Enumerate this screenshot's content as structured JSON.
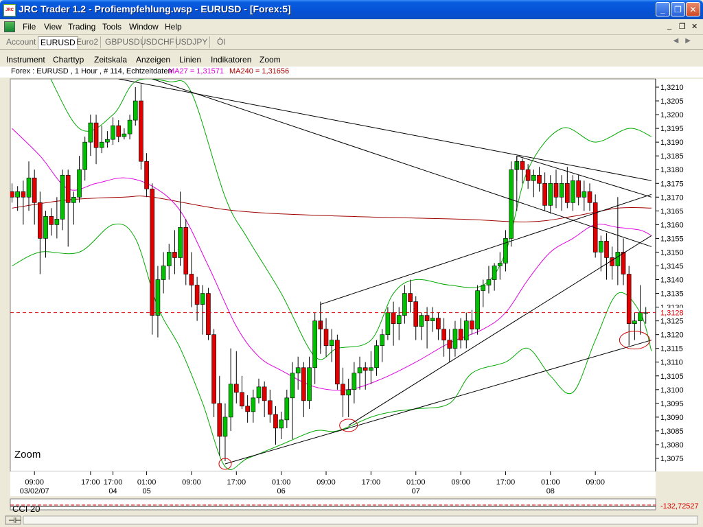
{
  "window": {
    "title": "JRC Trader 1.2 - Profiempfehlung.wsp - EURUSD - [Forex:5]",
    "icon_text": "JRC",
    "minimize": "_",
    "maximize": "❐",
    "close": "✕"
  },
  "menu": [
    "File",
    "View",
    "Trading",
    "Tools",
    "Window",
    "Help"
  ],
  "mdi": {
    "minimize": "_",
    "restore": "❐",
    "close": "✕"
  },
  "tabs": [
    "Account",
    "EURUSD",
    "Euro2",
    "GBPUSD",
    "USDCHF",
    "USDJPY",
    "Öl"
  ],
  "active_tab": "EURUSD",
  "chart_menu": [
    "Instrument",
    "Charttyp",
    "Zeitskala",
    "Anzeigen",
    "Linien",
    "Indikatoren",
    "Zoom"
  ],
  "info": {
    "main": "Forex : EURUSD , 1 Hour , # 114, Echtzeitdaten",
    "ma27": "MA27 = 1,31571",
    "ma240": "MA240 = 1,31656",
    "ma27_color": "#dd00dd",
    "ma240_color": "#aa0000"
  },
  "zoom_label": "Zoom",
  "cci": {
    "label": "CCI 20",
    "value": "-132,72527"
  },
  "colors": {
    "up": "#00c000",
    "down": "#e00000",
    "bollinger": "#00aa00",
    "ma27": "#e000e0",
    "ma240": "#a00000",
    "price_line": "#dd0000"
  },
  "chart_data": {
    "type": "candlestick",
    "instrument": "EURUSD",
    "timeframe": "1 Hour",
    "ylim": [
      1.307,
      1.3215
    ],
    "y_ticks": [
      "1,3210",
      "1,3205",
      "1,3200",
      "1,3195",
      "1,3190",
      "1,3185",
      "1,3180",
      "1,3175",
      "1,3170",
      "1,3165",
      "1,3160",
      "1,3155",
      "1,3150",
      "1,3145",
      "1,3140",
      "1,3135",
      "1,3130",
      "1,3125",
      "1,3120",
      "1,3115",
      "1,3110",
      "1,3105",
      "1,3100",
      "1,3095",
      "1,3090",
      "1,3085",
      "1,3080",
      "1,3075"
    ],
    "y_tick_values": [
      1.321,
      1.3205,
      1.32,
      1.3195,
      1.319,
      1.3185,
      1.318,
      1.3175,
      1.317,
      1.3165,
      1.316,
      1.3155,
      1.315,
      1.3145,
      1.314,
      1.3135,
      1.313,
      1.3125,
      1.312,
      1.3115,
      1.311,
      1.3105,
      1.31,
      1.3095,
      1.309,
      1.3085,
      1.308,
      1.3075
    ],
    "current_price": 1.3128,
    "current_price_label": "1,3128",
    "x_labels": [
      {
        "idx": 4,
        "time": "09:00",
        "date": "03/02/07"
      },
      {
        "idx": 14,
        "time": "17:00",
        "date": ""
      },
      {
        "idx": 18,
        "time": "17:00",
        "date": "04"
      },
      {
        "idx": 24,
        "time": "01:00",
        "date": "05"
      },
      {
        "idx": 32,
        "time": "09:00",
        "date": ""
      },
      {
        "idx": 40,
        "time": "17:00",
        "date": ""
      },
      {
        "idx": 48,
        "time": "01:00",
        "date": "06"
      },
      {
        "idx": 56,
        "time": "09:00",
        "date": ""
      },
      {
        "idx": 64,
        "time": "17:00",
        "date": ""
      },
      {
        "idx": 72,
        "time": "01:00",
        "date": "07"
      },
      {
        "idx": 80,
        "time": "09:00",
        "date": ""
      },
      {
        "idx": 88,
        "time": "17:00",
        "date": ""
      },
      {
        "idx": 96,
        "time": "01:00",
        "date": "08"
      },
      {
        "idx": 104,
        "time": "09:00",
        "date": ""
      }
    ],
    "candles": [
      {
        "o": 1.3172,
        "h": 1.3175,
        "l": 1.3168,
        "c": 1.317
      },
      {
        "o": 1.317,
        "h": 1.3174,
        "l": 1.3165,
        "c": 1.3172
      },
      {
        "o": 1.3172,
        "h": 1.3176,
        "l": 1.316,
        "c": 1.317
      },
      {
        "o": 1.317,
        "h": 1.3183,
        "l": 1.3165,
        "c": 1.3177
      },
      {
        "o": 1.3177,
        "h": 1.318,
        "l": 1.316,
        "c": 1.3168
      },
      {
        "o": 1.3168,
        "h": 1.3172,
        "l": 1.3142,
        "c": 1.3155
      },
      {
        "o": 1.3155,
        "h": 1.3165,
        "l": 1.3148,
        "c": 1.3163
      },
      {
        "o": 1.3163,
        "h": 1.3166,
        "l": 1.3156,
        "c": 1.316
      },
      {
        "o": 1.316,
        "h": 1.317,
        "l": 1.3155,
        "c": 1.3162
      },
      {
        "o": 1.3162,
        "h": 1.318,
        "l": 1.3158,
        "c": 1.3178
      },
      {
        "o": 1.3178,
        "h": 1.318,
        "l": 1.3152,
        "c": 1.3168
      },
      {
        "o": 1.3168,
        "h": 1.3172,
        "l": 1.316,
        "c": 1.317
      },
      {
        "o": 1.317,
        "h": 1.3185,
        "l": 1.3168,
        "c": 1.318
      },
      {
        "o": 1.318,
        "h": 1.3192,
        "l": 1.3176,
        "c": 1.319
      },
      {
        "o": 1.319,
        "h": 1.32,
        "l": 1.3185,
        "c": 1.3197
      },
      {
        "o": 1.3197,
        "h": 1.32,
        "l": 1.3182,
        "c": 1.3188
      },
      {
        "o": 1.3188,
        "h": 1.3196,
        "l": 1.3186,
        "c": 1.319
      },
      {
        "o": 1.319,
        "h": 1.3194,
        "l": 1.3188,
        "c": 1.3191
      },
      {
        "o": 1.3191,
        "h": 1.3199,
        "l": 1.3189,
        "c": 1.3196
      },
      {
        "o": 1.3196,
        "h": 1.3198,
        "l": 1.319,
        "c": 1.3192
      },
      {
        "o": 1.3192,
        "h": 1.3195,
        "l": 1.3191,
        "c": 1.3193
      },
      {
        "o": 1.3193,
        "h": 1.32,
        "l": 1.3191,
        "c": 1.3198
      },
      {
        "o": 1.3198,
        "h": 1.321,
        "l": 1.3196,
        "c": 1.3205
      },
      {
        "o": 1.3205,
        "h": 1.3211,
        "l": 1.318,
        "c": 1.3183
      },
      {
        "o": 1.3183,
        "h": 1.3186,
        "l": 1.317,
        "c": 1.3173
      },
      {
        "o": 1.3173,
        "h": 1.3175,
        "l": 1.312,
        "c": 1.3127
      },
      {
        "o": 1.3127,
        "h": 1.3145,
        "l": 1.3119,
        "c": 1.314
      },
      {
        "o": 1.314,
        "h": 1.315,
        "l": 1.3135,
        "c": 1.3145
      },
      {
        "o": 1.3145,
        "h": 1.3153,
        "l": 1.314,
        "c": 1.315
      },
      {
        "o": 1.315,
        "h": 1.3158,
        "l": 1.3142,
        "c": 1.3148
      },
      {
        "o": 1.3148,
        "h": 1.3172,
        "l": 1.3145,
        "c": 1.3159
      },
      {
        "o": 1.3159,
        "h": 1.3162,
        "l": 1.3138,
        "c": 1.3142
      },
      {
        "o": 1.3142,
        "h": 1.315,
        "l": 1.313,
        "c": 1.3138
      },
      {
        "o": 1.3138,
        "h": 1.3141,
        "l": 1.3125,
        "c": 1.3131
      },
      {
        "o": 1.3131,
        "h": 1.3138,
        "l": 1.312,
        "c": 1.3135
      },
      {
        "o": 1.3135,
        "h": 1.3137,
        "l": 1.3118,
        "c": 1.312
      },
      {
        "o": 1.312,
        "h": 1.3122,
        "l": 1.309,
        "c": 1.3095
      },
      {
        "o": 1.3095,
        "h": 1.3105,
        "l": 1.3076,
        "c": 1.3083
      },
      {
        "o": 1.3083,
        "h": 1.3095,
        "l": 1.3074,
        "c": 1.309
      },
      {
        "o": 1.309,
        "h": 1.3115,
        "l": 1.3085,
        "c": 1.3102
      },
      {
        "o": 1.3102,
        "h": 1.3114,
        "l": 1.3095,
        "c": 1.3099
      },
      {
        "o": 1.3099,
        "h": 1.3105,
        "l": 1.3093,
        "c": 1.3094
      },
      {
        "o": 1.3094,
        "h": 1.3098,
        "l": 1.3088,
        "c": 1.3092
      },
      {
        "o": 1.3092,
        "h": 1.31,
        "l": 1.3088,
        "c": 1.3097
      },
      {
        "o": 1.3097,
        "h": 1.3104,
        "l": 1.3095,
        "c": 1.3101
      },
      {
        "o": 1.3101,
        "h": 1.3103,
        "l": 1.309,
        "c": 1.3096
      },
      {
        "o": 1.3096,
        "h": 1.31,
        "l": 1.3088,
        "c": 1.3091
      },
      {
        "o": 1.3091,
        "h": 1.3094,
        "l": 1.308,
        "c": 1.3086
      },
      {
        "o": 1.3086,
        "h": 1.3092,
        "l": 1.3082,
        "c": 1.3089
      },
      {
        "o": 1.3089,
        "h": 1.31,
        "l": 1.3086,
        "c": 1.3097
      },
      {
        "o": 1.3097,
        "h": 1.311,
        "l": 1.3082,
        "c": 1.3106
      },
      {
        "o": 1.3106,
        "h": 1.3112,
        "l": 1.31,
        "c": 1.3108
      },
      {
        "o": 1.3108,
        "h": 1.311,
        "l": 1.309,
        "c": 1.3096
      },
      {
        "o": 1.3096,
        "h": 1.3112,
        "l": 1.3093,
        "c": 1.3108
      },
      {
        "o": 1.3108,
        "h": 1.3128,
        "l": 1.3102,
        "c": 1.3125
      },
      {
        "o": 1.3125,
        "h": 1.3132,
        "l": 1.3115,
        "c": 1.3122
      },
      {
        "o": 1.3122,
        "h": 1.3126,
        "l": 1.3112,
        "c": 1.3116
      },
      {
        "o": 1.3116,
        "h": 1.3122,
        "l": 1.311,
        "c": 1.3118
      },
      {
        "o": 1.3118,
        "h": 1.312,
        "l": 1.31,
        "c": 1.3102
      },
      {
        "o": 1.3102,
        "h": 1.3108,
        "l": 1.309,
        "c": 1.3098
      },
      {
        "o": 1.3098,
        "h": 1.3104,
        "l": 1.309,
        "c": 1.31
      },
      {
        "o": 1.31,
        "h": 1.311,
        "l": 1.3095,
        "c": 1.3106
      },
      {
        "o": 1.3106,
        "h": 1.3112,
        "l": 1.31,
        "c": 1.3108
      },
      {
        "o": 1.3108,
        "h": 1.311,
        "l": 1.31,
        "c": 1.3107
      },
      {
        "o": 1.3107,
        "h": 1.3114,
        "l": 1.3102,
        "c": 1.3108
      },
      {
        "o": 1.3108,
        "h": 1.3118,
        "l": 1.3105,
        "c": 1.3116
      },
      {
        "o": 1.3116,
        "h": 1.3122,
        "l": 1.311,
        "c": 1.312
      },
      {
        "o": 1.312,
        "h": 1.313,
        "l": 1.3118,
        "c": 1.3128
      },
      {
        "o": 1.3128,
        "h": 1.3132,
        "l": 1.3116,
        "c": 1.3124
      },
      {
        "o": 1.3124,
        "h": 1.313,
        "l": 1.3118,
        "c": 1.3127
      },
      {
        "o": 1.3127,
        "h": 1.3138,
        "l": 1.3124,
        "c": 1.3135
      },
      {
        "o": 1.3135,
        "h": 1.314,
        "l": 1.3128,
        "c": 1.3132
      },
      {
        "o": 1.3132,
        "h": 1.3134,
        "l": 1.3118,
        "c": 1.3123
      },
      {
        "o": 1.3123,
        "h": 1.3128,
        "l": 1.3118,
        "c": 1.3127
      },
      {
        "o": 1.3127,
        "h": 1.313,
        "l": 1.3115,
        "c": 1.3125
      },
      {
        "o": 1.3125,
        "h": 1.313,
        "l": 1.3121,
        "c": 1.3126
      },
      {
        "o": 1.3126,
        "h": 1.3128,
        "l": 1.3118,
        "c": 1.3122
      },
      {
        "o": 1.3122,
        "h": 1.3126,
        "l": 1.3112,
        "c": 1.3118
      },
      {
        "o": 1.3118,
        "h": 1.3122,
        "l": 1.311,
        "c": 1.3115
      },
      {
        "o": 1.3115,
        "h": 1.3125,
        "l": 1.3112,
        "c": 1.3122
      },
      {
        "o": 1.3122,
        "h": 1.3126,
        "l": 1.3115,
        "c": 1.3118
      },
      {
        "o": 1.3118,
        "h": 1.3128,
        "l": 1.3115,
        "c": 1.3125
      },
      {
        "o": 1.3125,
        "h": 1.3129,
        "l": 1.312,
        "c": 1.3122
      },
      {
        "o": 1.3122,
        "h": 1.3138,
        "l": 1.312,
        "c": 1.3136
      },
      {
        "o": 1.3136,
        "h": 1.314,
        "l": 1.313,
        "c": 1.3138
      },
      {
        "o": 1.3138,
        "h": 1.3145,
        "l": 1.3135,
        "c": 1.314
      },
      {
        "o": 1.314,
        "h": 1.3146,
        "l": 1.3136,
        "c": 1.3145
      },
      {
        "o": 1.3145,
        "h": 1.315,
        "l": 1.314,
        "c": 1.3146
      },
      {
        "o": 1.3146,
        "h": 1.3158,
        "l": 1.3143,
        "c": 1.3155
      },
      {
        "o": 1.3155,
        "h": 1.3183,
        "l": 1.3152,
        "c": 1.318
      },
      {
        "o": 1.318,
        "h": 1.3185,
        "l": 1.3176,
        "c": 1.3183
      },
      {
        "o": 1.3183,
        "h": 1.3184,
        "l": 1.3175,
        "c": 1.318
      },
      {
        "o": 1.318,
        "h": 1.3182,
        "l": 1.3173,
        "c": 1.3176
      },
      {
        "o": 1.3176,
        "h": 1.318,
        "l": 1.317,
        "c": 1.3178
      },
      {
        "o": 1.3178,
        "h": 1.3181,
        "l": 1.3172,
        "c": 1.3175
      },
      {
        "o": 1.3175,
        "h": 1.3179,
        "l": 1.3165,
        "c": 1.3167
      },
      {
        "o": 1.3167,
        "h": 1.3178,
        "l": 1.3164,
        "c": 1.3175
      },
      {
        "o": 1.3175,
        "h": 1.318,
        "l": 1.3166,
        "c": 1.317
      },
      {
        "o": 1.317,
        "h": 1.3178,
        "l": 1.3165,
        "c": 1.3175
      },
      {
        "o": 1.3175,
        "h": 1.3181,
        "l": 1.3166,
        "c": 1.3168
      },
      {
        "o": 1.3168,
        "h": 1.3178,
        "l": 1.3165,
        "c": 1.3176
      },
      {
        "o": 1.3176,
        "h": 1.3178,
        "l": 1.3167,
        "c": 1.317
      },
      {
        "o": 1.317,
        "h": 1.3176,
        "l": 1.3165,
        "c": 1.3172
      },
      {
        "o": 1.3172,
        "h": 1.3175,
        "l": 1.3165,
        "c": 1.3168
      },
      {
        "o": 1.3168,
        "h": 1.3171,
        "l": 1.3148,
        "c": 1.315
      },
      {
        "o": 1.315,
        "h": 1.3156,
        "l": 1.3143,
        "c": 1.3154
      },
      {
        "o": 1.3154,
        "h": 1.3157,
        "l": 1.314,
        "c": 1.3148
      },
      {
        "o": 1.3148,
        "h": 1.3152,
        "l": 1.314,
        "c": 1.3145
      },
      {
        "o": 1.3145,
        "h": 1.317,
        "l": 1.3138,
        "c": 1.315
      },
      {
        "o": 1.315,
        "h": 1.3155,
        "l": 1.3138,
        "c": 1.3142
      },
      {
        "o": 1.3142,
        "h": 1.3145,
        "l": 1.3116,
        "c": 1.3124
      },
      {
        "o": 1.3124,
        "h": 1.3128,
        "l": 1.3118,
        "c": 1.3125
      },
      {
        "o": 1.3125,
        "h": 1.3138,
        "l": 1.312,
        "c": 1.3128
      },
      {
        "o": 1.3128,
        "h": 1.313,
        "l": 1.3124,
        "c": 1.3128
      }
    ],
    "bollinger_upper": [
      [
        0,
        1.323
      ],
      [
        5,
        1.322
      ],
      [
        12,
        1.3195
      ],
      [
        18,
        1.32
      ],
      [
        22,
        1.3212
      ],
      [
        28,
        1.3212
      ],
      [
        32,
        1.3208
      ],
      [
        38,
        1.317
      ],
      [
        42,
        1.3155
      ],
      [
        48,
        1.3135
      ],
      [
        54,
        1.3112
      ],
      [
        58,
        1.3115
      ],
      [
        64,
        1.3118
      ],
      [
        68,
        1.3135
      ],
      [
        72,
        1.314
      ],
      [
        78,
        1.3138
      ],
      [
        84,
        1.3138
      ],
      [
        88,
        1.315
      ],
      [
        92,
        1.318
      ],
      [
        98,
        1.3195
      ],
      [
        104,
        1.319
      ],
      [
        110,
        1.3195
      ],
      [
        114,
        1.3192
      ]
    ],
    "bollinger_lower": [
      [
        0,
        1.3145
      ],
      [
        5,
        1.315
      ],
      [
        12,
        1.315
      ],
      [
        18,
        1.316
      ],
      [
        22,
        1.3155
      ],
      [
        26,
        1.313
      ],
      [
        30,
        1.3115
      ],
      [
        34,
        1.3095
      ],
      [
        38,
        1.3072
      ],
      [
        42,
        1.3075
      ],
      [
        48,
        1.308
      ],
      [
        54,
        1.3085
      ],
      [
        58,
        1.3085
      ],
      [
        64,
        1.309
      ],
      [
        68,
        1.3092
      ],
      [
        72,
        1.3093
      ],
      [
        78,
        1.3095
      ],
      [
        82,
        1.3106
      ],
      [
        88,
        1.311
      ],
      [
        92,
        1.3115
      ],
      [
        96,
        1.3105
      ],
      [
        100,
        1.3099
      ],
      [
        104,
        1.3118
      ],
      [
        108,
        1.3135
      ],
      [
        112,
        1.3128
      ],
      [
        114,
        1.3114
      ]
    ],
    "ma27": [
      [
        0,
        1.3195
      ],
      [
        5,
        1.3185
      ],
      [
        10,
        1.3173
      ],
      [
        15,
        1.3175
      ],
      [
        20,
        1.3177
      ],
      [
        25,
        1.3174
      ],
      [
        30,
        1.3165
      ],
      [
        35,
        1.3145
      ],
      [
        40,
        1.3123
      ],
      [
        44,
        1.3112
      ],
      [
        48,
        1.3107
      ],
      [
        54,
        1.3101
      ],
      [
        60,
        1.31
      ],
      [
        66,
        1.3104
      ],
      [
        72,
        1.311
      ],
      [
        78,
        1.3117
      ],
      [
        84,
        1.3122
      ],
      [
        88,
        1.3128
      ],
      [
        92,
        1.314
      ],
      [
        96,
        1.315
      ],
      [
        100,
        1.3155
      ],
      [
        104,
        1.316
      ],
      [
        108,
        1.3159
      ],
      [
        112,
        1.3158
      ],
      [
        114,
        1.3156
      ]
    ],
    "ma240": [
      [
        0,
        1.3166
      ],
      [
        10,
        1.3169
      ],
      [
        20,
        1.317
      ],
      [
        25,
        1.317
      ],
      [
        40,
        1.3165
      ],
      [
        60,
        1.3163
      ],
      [
        80,
        1.3162
      ],
      [
        92,
        1.3161
      ],
      [
        100,
        1.3163
      ],
      [
        108,
        1.3166
      ],
      [
        114,
        1.3166
      ]
    ],
    "trendlines": [
      [
        [
          19,
          1.3213
        ],
        [
          114,
          1.3176
        ]
      ],
      [
        [
          25,
          1.3213
        ],
        [
          114,
          1.3152
        ]
      ],
      [
        [
          55,
          1.3131
        ],
        [
          114,
          1.3171
        ]
      ],
      [
        [
          38,
          1.3073
        ],
        [
          114,
          1.3118
        ]
      ],
      [
        [
          60,
          1.3087
        ],
        [
          114,
          1.3156
        ]
      ],
      [
        [
          90,
          1.3185
        ],
        [
          114,
          1.317
        ]
      ]
    ],
    "circles": [
      [
        38,
        1.3073
      ],
      [
        60,
        1.3087
      ],
      [
        111,
        1.3118
      ]
    ]
  }
}
